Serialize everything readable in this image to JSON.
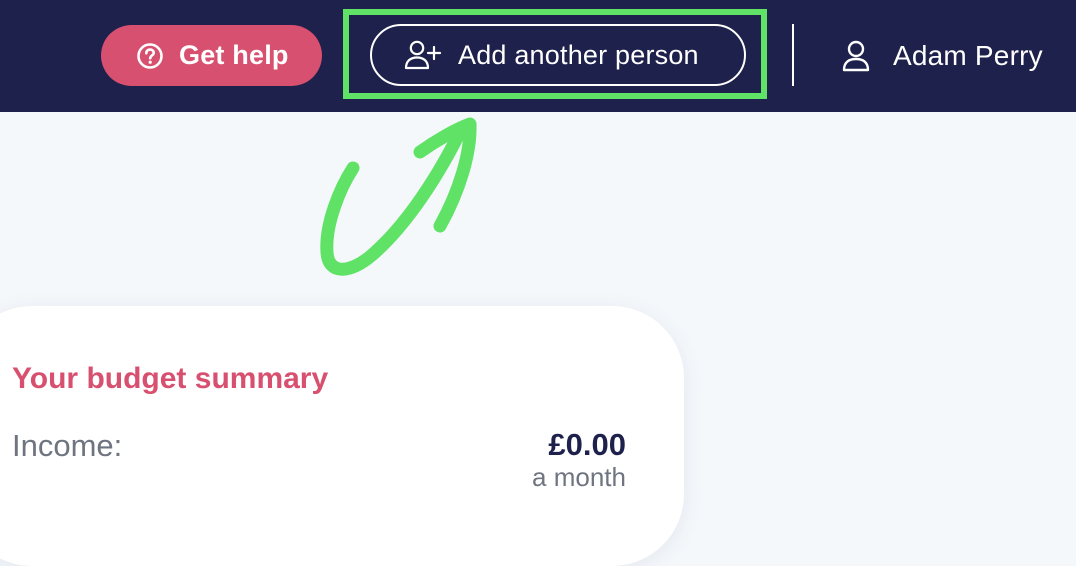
{
  "header": {
    "help_label": "Get help",
    "add_person_label": "Add another person",
    "user_name": "Adam Perry"
  },
  "icons": {
    "help": "question-circle-icon",
    "add_person": "user-plus-icon",
    "user": "user-icon",
    "annotation": "hand-drawn-arrow-icon"
  },
  "colors": {
    "header_bg": "#1e214b",
    "accent_pink": "#d8506f",
    "highlight_green": "#5fe266",
    "page_bg": "#f5f8fb"
  },
  "summary": {
    "title": "Your budget summary",
    "income_label": "Income:",
    "income_value": "£0.00",
    "income_period": "a month"
  }
}
